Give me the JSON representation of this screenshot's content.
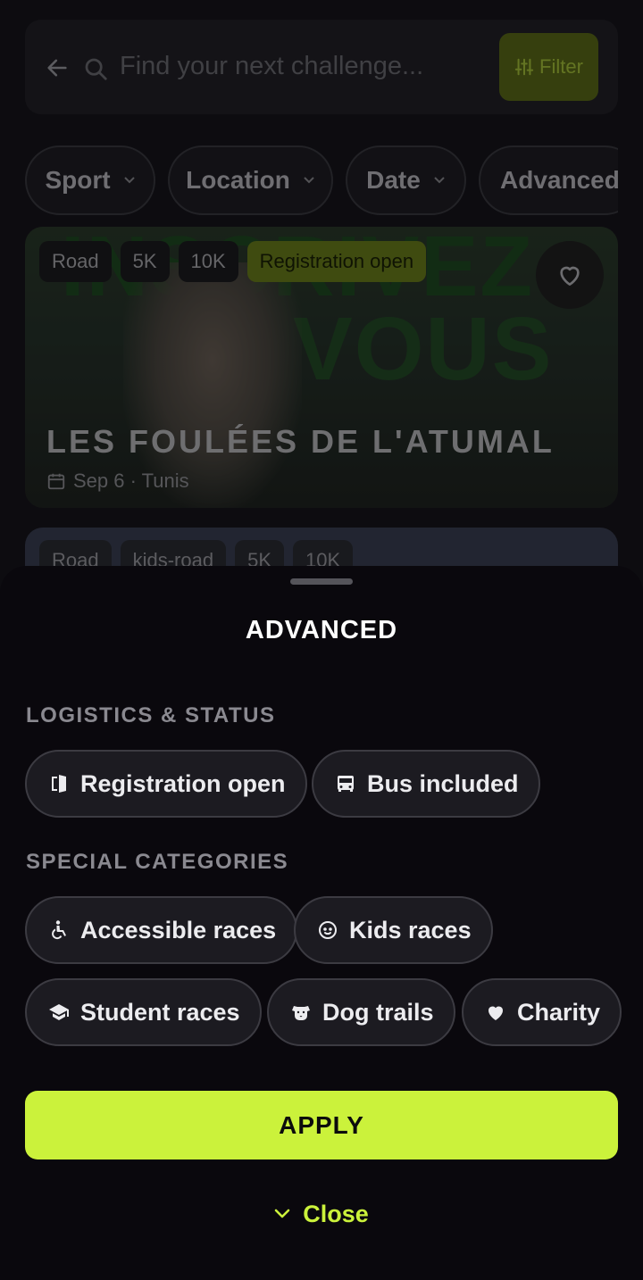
{
  "search": {
    "placeholder": "Find your next challenge...",
    "filter_label": "Filter"
  },
  "filter_chips": [
    {
      "label": "Sport"
    },
    {
      "label": "Location"
    },
    {
      "label": "Date"
    },
    {
      "label": "Advanced"
    }
  ],
  "events": [
    {
      "tags": [
        "Road",
        "5K",
        "10K",
        "Registration open"
      ],
      "title": "LES FOULÉES DE L'ATUMAL",
      "meta": "Sep 6 · Tunis",
      "poster_text_1": "INSCRIVEZ",
      "poster_text_2": "VOUS"
    },
    {
      "tags": [
        "Road",
        "kids-road",
        "5K",
        "10K"
      ]
    }
  ],
  "sheet": {
    "title": "ADVANCED",
    "sections": [
      {
        "label": "LOGISTICS & STATUS",
        "options": [
          {
            "label": "Registration open",
            "icon": "door-open-icon"
          },
          {
            "label": "Bus included",
            "icon": "bus-icon"
          }
        ]
      },
      {
        "label": "SPECIAL CATEGORIES",
        "options": [
          {
            "label": "Accessible races",
            "icon": "accessible-icon"
          },
          {
            "label": "Kids races",
            "icon": "child-face-icon"
          },
          {
            "label": "Student races",
            "icon": "graduation-cap-icon"
          },
          {
            "label": "Dog trails",
            "icon": "dog-icon"
          },
          {
            "label": "Charity",
            "icon": "heart-icon"
          }
        ]
      }
    ],
    "apply_label": "APPLY",
    "close_label": "Close"
  },
  "colors": {
    "accent": "#cbf23b",
    "sheet_bg": "#0a080d",
    "chip_bg": "#1c1b21"
  }
}
